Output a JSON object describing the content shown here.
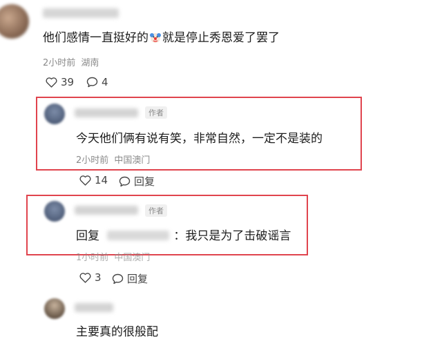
{
  "comment1": {
    "text_before_emoji": "他们感情一直挺好的",
    "emoji_icon": "clown-face-icon",
    "text_after_emoji": "就是停止秀恩爱了罢了",
    "time": "2小时前",
    "location": "湖南",
    "likes": "39",
    "replies": "4"
  },
  "reply1": {
    "badge": "作者",
    "text": "今天他们俩有说有笑，非常自然，一定不是装的",
    "time": "2小时前",
    "location": "中国澳门",
    "likes": "14",
    "reply_label": "回复"
  },
  "reply2": {
    "badge": "作者",
    "reply_prefix": "回复",
    "text": "：我只是为了击破谣言",
    "time": "1小时前",
    "location": "中国澳门",
    "likes": "3",
    "reply_label": "回复"
  },
  "reply3": {
    "text": "主要真的很般配"
  },
  "colors": {
    "highlight_border": "#e0434d",
    "meta_text": "#8a8a8a"
  }
}
